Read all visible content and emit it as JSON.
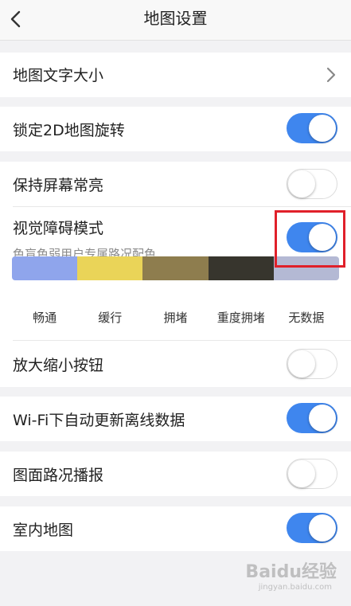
{
  "header": {
    "title": "地图设置",
    "back_icon": "chevron-left-icon"
  },
  "colors": {
    "toggle_on": "#3f86ee",
    "highlight_border": "#e0202a"
  },
  "settings": {
    "map_text_size": {
      "label": "地图文字大小"
    },
    "lock_2d_rotation": {
      "label": "锁定2D地图旋转",
      "on": true
    },
    "keep_screen_on": {
      "label": "保持屏幕常亮",
      "on": false
    },
    "visual_impairment_mode": {
      "label": "视觉障碍模式",
      "sublabel": "色盲色弱用户专属路况配色",
      "on": true
    },
    "zoom_buttons": {
      "label": "放大缩小按钮",
      "on": false
    },
    "wifi_offline_update": {
      "label": "Wi-Fi下自动更新离线数据",
      "on": true
    },
    "traffic_broadcast": {
      "label": "图面路况播报",
      "on": false
    },
    "indoor_map": {
      "label": "室内地图",
      "on": true
    }
  },
  "traffic_legend": [
    {
      "label": "畅通",
      "color": "#8fa5ec"
    },
    {
      "label": "缓行",
      "color": "#ead458"
    },
    {
      "label": "拥堵",
      "color": "#8e7d4e"
    },
    {
      "label": "重度拥堵",
      "color": "#37352d"
    },
    {
      "label": "无数据",
      "color": "#b4b9d4"
    }
  ],
  "watermark": {
    "text": "Baidu经验",
    "sub": "jingyan.baidu.com"
  }
}
